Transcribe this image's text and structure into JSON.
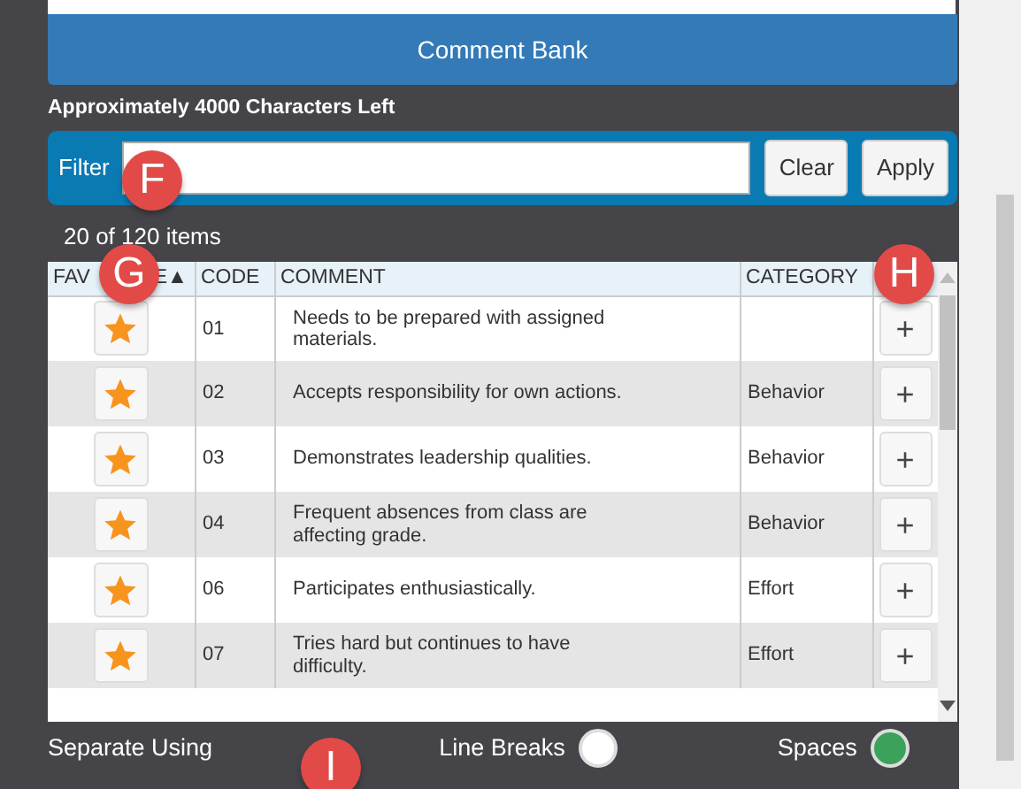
{
  "header_button": "Comment Bank",
  "characters_left": "Approximately 4000 Characters Left",
  "filter": {
    "label": "Filter",
    "buttons": [
      "Clear",
      "Apply"
    ]
  },
  "item_count": "20 of 120 items",
  "table": {
    "columns": [
      {
        "label": "FAV",
        "label_after_callout": "E",
        "sort": "▲"
      },
      {
        "label": "CODE"
      },
      {
        "label": "COMMENT"
      },
      {
        "label": "CATEGORY"
      }
    ],
    "rows": [
      {
        "favorite": true,
        "code": "01",
        "comment": "Needs to be prepared with assigned materials.",
        "category": "",
        "add": "+"
      },
      {
        "favorite": true,
        "code": "02",
        "comment": "Accepts responsibility for own actions.",
        "category": "Behavior",
        "add": "+"
      },
      {
        "favorite": true,
        "code": "03",
        "comment": "Demonstrates leadership qualities.",
        "category": "Behavior",
        "add": "+"
      },
      {
        "favorite": true,
        "code": "04",
        "comment": "Frequent absences from class are affecting grade.",
        "category": "Behavior",
        "add": "+"
      },
      {
        "favorite": true,
        "code": "06",
        "comment": "Participates enthusiastically.",
        "category": "Effort",
        "add": "+"
      },
      {
        "favorite": true,
        "code": "07",
        "comment": "Tries hard but continues to have difficulty.",
        "category": "Effort",
        "add": "+"
      }
    ]
  },
  "separate": {
    "label": "Separate Using",
    "options": [
      {
        "label": "Line Breaks",
        "selected": false
      },
      {
        "label": "Spaces",
        "selected": true
      }
    ]
  },
  "callouts": [
    {
      "letter": "F"
    },
    {
      "letter": "G"
    },
    {
      "letter": "H"
    },
    {
      "letter": "I"
    }
  ]
}
